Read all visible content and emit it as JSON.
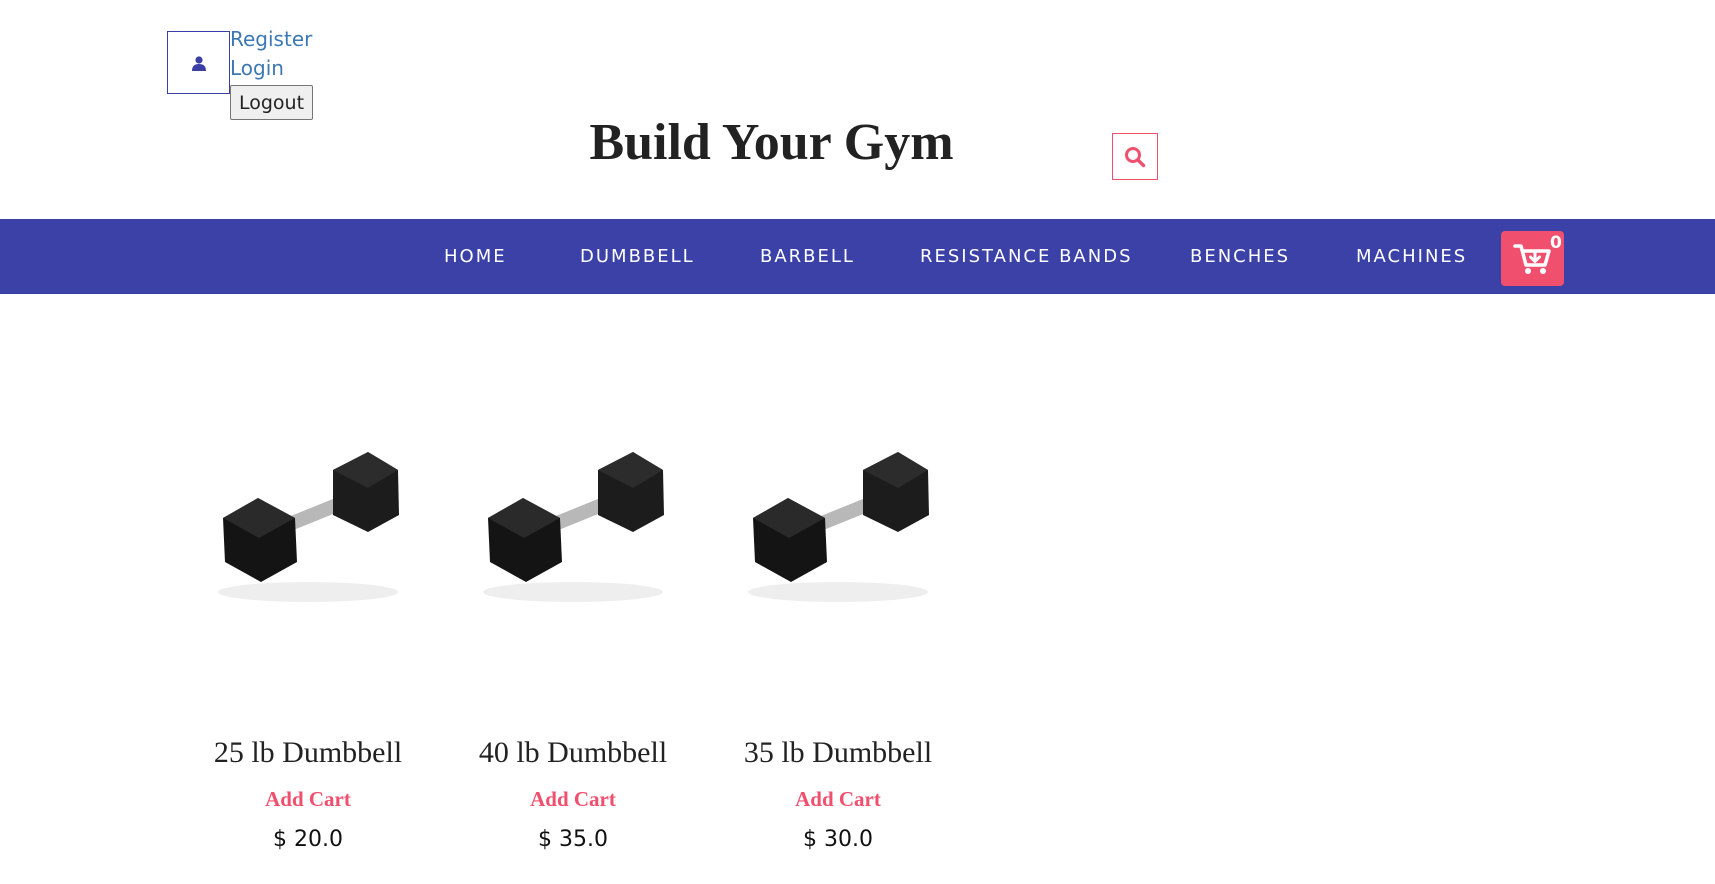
{
  "header": {
    "user_icon": "user-icon",
    "register_label": "Register",
    "login_label": "Login",
    "logout_label": "Logout",
    "site_title": "Build Your Gym",
    "search_icon": "search-icon"
  },
  "nav": {
    "items": [
      {
        "label": "HOME"
      },
      {
        "label": "DUMBBELL"
      },
      {
        "label": "BARBELL"
      },
      {
        "label": "RESISTANCE BANDS"
      },
      {
        "label": "BENCHES"
      },
      {
        "label": "MACHINES"
      }
    ],
    "cart_icon": "cart-icon",
    "cart_count": "0"
  },
  "products": [
    {
      "name": "25 lb Dumbbell",
      "add_cart_label": "Add Cart",
      "price": "$ 20.0",
      "image": "dumbbell-image"
    },
    {
      "name": "40 lb Dumbbell",
      "add_cart_label": "Add Cart",
      "price": "$ 35.0",
      "image": "dumbbell-image"
    },
    {
      "name": "35 lb Dumbbell",
      "add_cart_label": "Add Cart",
      "price": "$ 30.0",
      "image": "dumbbell-image"
    }
  ],
  "colors": {
    "navbar_bg": "#3b41a6",
    "accent": "#f0506e",
    "link": "#3d78b4"
  }
}
